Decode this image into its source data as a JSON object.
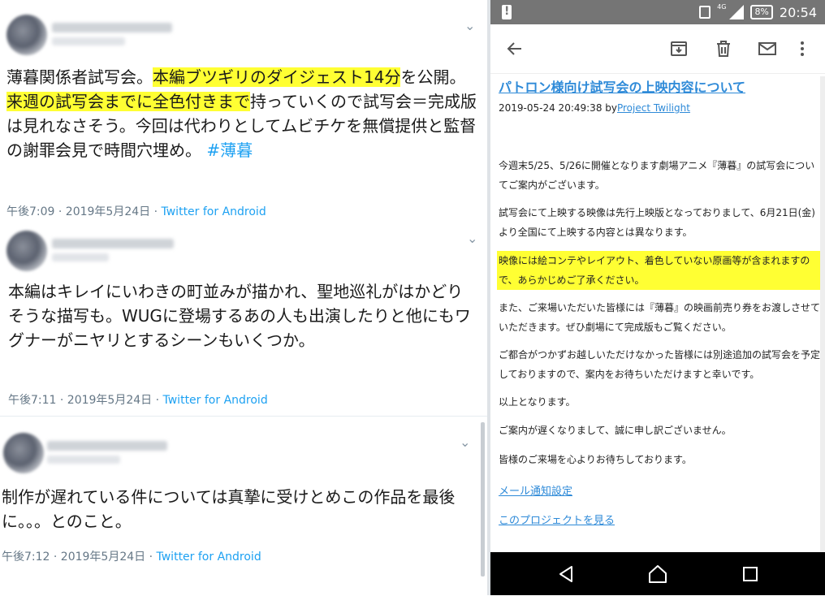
{
  "tweets": [
    {
      "segments": [
        {
          "text": "薄暮関係者試写会。",
          "hl": false
        },
        {
          "text": "本編ブツギリのダイジェスト14分",
          "hl": true
        },
        {
          "text": "を公開。",
          "hl": false
        },
        {
          "text": "来週の試写会までに全色付きまで",
          "hl": true
        },
        {
          "text": "持っていくので試写会＝完成版は見れなさそう。今回は代わりとしてムビチケを無償提供と監督の謝罪会見で時間穴埋め。 ",
          "hl": false
        }
      ],
      "hashtag": "#薄暮",
      "time": "午後7:09 · 2019年5月24日 · ",
      "source": "Twitter for Android"
    },
    {
      "text": "本編はキレイにいわきの町並みが描かれ、聖地巡礼がはかどりそうな描写も。WUGに登場するあの人も出演したりと他にもワグナーがニヤリとするシーンもいくつか。",
      "time": "午後7:11 · 2019年5月24日 · ",
      "source": "Twitter for Android"
    },
    {
      "text": "制作が遅れている件については真摯に受けとめこの作品を最後に。。。とのこと。",
      "time": "午後7:12 · 2019年5月24日 · ",
      "source": "Twitter for Android"
    }
  ],
  "status_bar": {
    "network": "4G",
    "battery": "8%",
    "clock": "20:54"
  },
  "toolbar_icons": [
    "back-arrow-icon",
    "archive-icon",
    "trash-icon",
    "mail-icon",
    "more-vert-icon"
  ],
  "email": {
    "subject": "パトロン様向け試写会の上映内容について",
    "date": "2019-05-24 20:49:38 by",
    "author": "Project Twilight",
    "paragraphs": [
      "今週末5/25、5/26に開催となります劇場アニメ『薄暮』の試写会についてご案内がございます。",
      "試写会にて上映する映像は先行上映版となっておりまして、6月21日(金)より全国にて上映する内容とは異なります。",
      "映像には絵コンテやレイアウト、着色していない原画等が含まれますので、あらかじめご了承ください。",
      "また、ご来場いただいた皆様には『薄暮』の映画前売り券をお渡しさせていただきます。ぜひ劇場にて完成版もご覧ください。",
      "ご都合がつかずお越しいただけなかった皆様には別途追加の試写会を予定しておりますので、案内をお待ちいただけますと幸いです。",
      "以上となります。",
      "ご案内が遅くなりまして、誠に申し訳ございません。",
      "皆様のご来場を心よりお待ちしております。"
    ],
    "links": [
      "メール通知設定",
      "このプロジェクトを見る"
    ]
  },
  "colors": {
    "highlight": "#ffff33",
    "link": "#2e8ad8",
    "twitter_blue": "#1da1f2",
    "status_bar": "#757575"
  }
}
